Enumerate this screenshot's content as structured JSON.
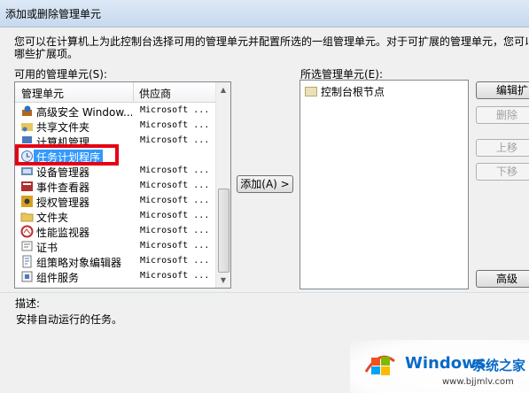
{
  "window": {
    "title": "添加或删除管理单元"
  },
  "intro": {
    "line1": "您可以在计算机上为此控制台选择可用的管理单元并配置所选的一组管理单元。对于可扩展的管理单元，您可以",
    "line2": "哪些扩展项。"
  },
  "available": {
    "label": "可用的管理单元(S):",
    "col_name": "管理单元",
    "col_vendor": "供应商",
    "items": [
      {
        "name": "高级安全 Window...",
        "vendor": "Microsoft ...",
        "icon": "firewall-icon"
      },
      {
        "name": "共享文件夹",
        "vendor": "Microsoft ...",
        "icon": "shared-folder-icon"
      },
      {
        "name": "计算机管理",
        "vendor": "Microsoft ...",
        "icon": "computer-management-icon"
      },
      {
        "name": "任务计划程序",
        "vendor": "",
        "icon": "clock-icon"
      },
      {
        "name": "设备管理器",
        "vendor": "Microsoft ...",
        "icon": "device-manager-icon"
      },
      {
        "name": "事件查看器",
        "vendor": "Microsoft ...",
        "icon": "event-viewer-icon"
      },
      {
        "name": "授权管理器",
        "vendor": "Microsoft ...",
        "icon": "authorization-icon"
      },
      {
        "name": "文件夹",
        "vendor": "Microsoft ...",
        "icon": "folder-icon"
      },
      {
        "name": "性能监视器",
        "vendor": "Microsoft ...",
        "icon": "performance-icon"
      },
      {
        "name": "证书",
        "vendor": "Microsoft ...",
        "icon": "certificate-icon"
      },
      {
        "name": "组策略对象编辑器",
        "vendor": "Microsoft ...",
        "icon": "group-policy-icon"
      },
      {
        "name": "组件服务",
        "vendor": "Microsoft ...",
        "icon": "component-services-icon"
      }
    ]
  },
  "add_button": {
    "label": "添加(A) >"
  },
  "selected": {
    "label": "所选管理单元(E):",
    "root_node": "控制台根节点"
  },
  "right_buttons": {
    "edit": "编辑扩",
    "remove": "删除",
    "up": "上移",
    "down": "下移",
    "advanced": "高级"
  },
  "description": {
    "label": "描述:",
    "text": "安排自动运行的任务。"
  },
  "watermark": {
    "brand": "Windows",
    "cn": "系统之家",
    "url": "www.bjjmlv.com"
  },
  "colors": {
    "highlight": "#e60012",
    "selection": "#3399ff",
    "brand": "#0a6ac7"
  }
}
